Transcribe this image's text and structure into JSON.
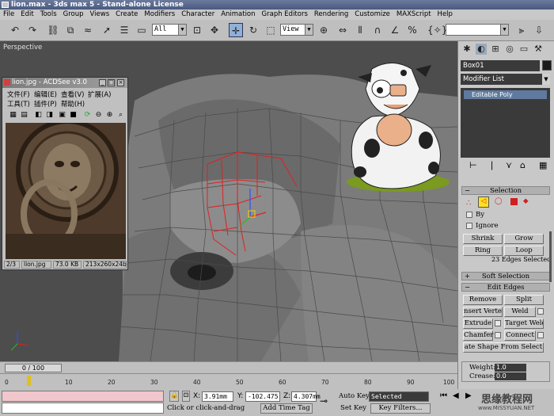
{
  "window": {
    "title": "lion.max - 3ds max 5 - Stand-alone License"
  },
  "menu": [
    "File",
    "Edit",
    "Tools",
    "Group",
    "Views",
    "Create",
    "Modifiers",
    "Character",
    "Animation",
    "Graph Editors",
    "Rendering",
    "Customize",
    "MAXScript",
    "Help"
  ],
  "toolbar": {
    "selection_filter": "All",
    "ref_coord": "View"
  },
  "viewport": {
    "label": "Perspective"
  },
  "acdsee": {
    "title": "lion.jpg - ACDSee v3.0",
    "menu_row1": [
      "文件(F)",
      "编辑(E)",
      "查看(V)",
      "扩展(A)"
    ],
    "menu_row2": [
      "工具(T)",
      "插件(P)",
      "帮助(H)"
    ],
    "status": {
      "index": "2/3",
      "filename": "lion.jpg",
      "size": "73.0 KB",
      "dims": "213x260x24b"
    }
  },
  "command_panel": {
    "object_name": "Box01",
    "modifier_list": "Modifier List",
    "stack_item": "Editable Poly",
    "selection": {
      "title": "Selection",
      "by_label": "By",
      "ignore_label": "Ignore",
      "shrink": "Shrink",
      "grow": "Grow",
      "ring": "Ring",
      "loop": "Loop",
      "status": "23 Edges Selected"
    },
    "soft_selection": {
      "title": "Soft Selection"
    },
    "edit_edges": {
      "title": "Edit Edges",
      "remove": "Remove",
      "split": "Split",
      "insert_vertex": "nsert Verte",
      "weld": "Weld",
      "extrude": "Extrude",
      "target_weld": "Target Weld",
      "chamfer": "Chamfer",
      "connect": "Connect",
      "create_shape": "ate Shape From Select",
      "weight_label": "Weight:",
      "weight_value": "1.0",
      "crease_label": "Crease:",
      "crease_value": "0.0"
    }
  },
  "timeline": {
    "slider": "0 / 100",
    "ticks": [
      "0",
      "10",
      "20",
      "30",
      "40",
      "50",
      "60",
      "70",
      "80",
      "90",
      "100"
    ]
  },
  "status": {
    "x_label": "X:",
    "x": "3.91mm",
    "y_label": "Y:",
    "y": "-102.475",
    "z_label": "Z:",
    "z": "4.307mm",
    "prompt": "Click or click-and-drag",
    "add_time_tag": "Add Time Tag",
    "auto_key": "Auto Key",
    "set_key": "Set Key",
    "key_mode": "Selected",
    "key_filters": "Key Filters...",
    "watermark": "思缘教程网",
    "watermark_url": "www.MISSYUAN.NET"
  },
  "colors": {
    "title_bar": "#4a5a80",
    "selection_edges": "#e02020",
    "stack_highlight": "#5f7a9e"
  }
}
